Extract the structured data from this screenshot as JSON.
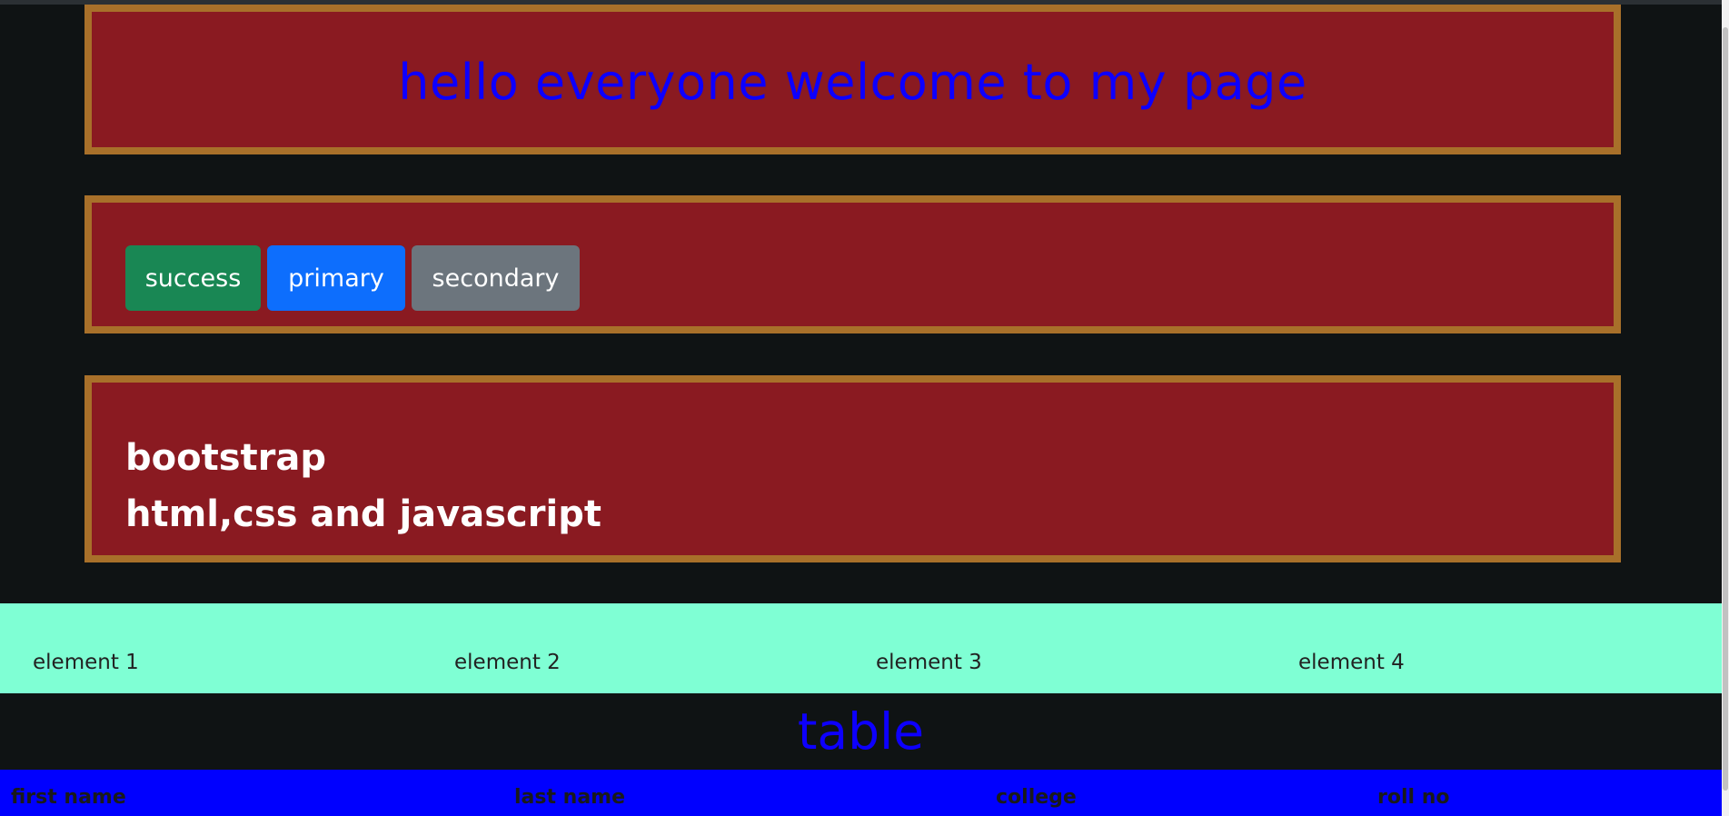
{
  "header": {
    "title": "hello everyone welcome to my page"
  },
  "buttons": {
    "success": "success",
    "primary": "primary",
    "secondary": "secondary"
  },
  "text_panel": {
    "line1": "bootstrap",
    "line2": "html,css and javascript"
  },
  "elements": [
    "element 1",
    "element 2",
    "element 3",
    "element 4"
  ],
  "table": {
    "heading": "table",
    "columns": [
      "first name",
      "last name",
      "college",
      "roll no"
    ]
  },
  "colors": {
    "panel_bg": "#8a1a21",
    "panel_border": "#a8702a",
    "heading_text": "#0d00ff",
    "row_bg": "#7fffd4",
    "table_head_bg": "#0000ff"
  }
}
